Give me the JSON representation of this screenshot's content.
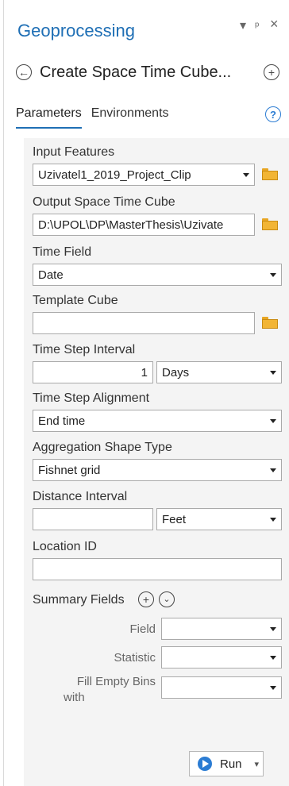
{
  "header": {
    "title": "Geoprocessing",
    "controls": {
      "menu": "▾",
      "pin": "ᵖ",
      "close": "×"
    }
  },
  "tool": {
    "name": "Create Space Time Cube...",
    "back_glyph": "←",
    "add_glyph": "+"
  },
  "tabs": [
    {
      "label": "Parameters",
      "active": true
    },
    {
      "label": "Environments",
      "active": false
    }
  ],
  "help_glyph": "?",
  "params": {
    "input_features": {
      "label": "Input Features",
      "value": "Uzivatel1_2019_Project_Clip"
    },
    "output_cube": {
      "label": "Output Space Time Cube",
      "value": "D:\\UPOL\\DP\\MasterThesis\\Uzivate"
    },
    "time_field": {
      "label": "Time Field",
      "value": "Date"
    },
    "template_cube": {
      "label": "Template Cube",
      "value": ""
    },
    "time_step_interval": {
      "label": "Time Step Interval",
      "value": "1",
      "unit": "Days"
    },
    "time_step_alignment": {
      "label": "Time Step Alignment",
      "value": "End time"
    },
    "aggregation_shape": {
      "label": "Aggregation Shape Type",
      "value": "Fishnet grid"
    },
    "distance_interval": {
      "label": "Distance Interval",
      "value": "",
      "unit": "Feet"
    },
    "location_id": {
      "label": "Location ID",
      "value": ""
    },
    "summary_fields": {
      "label": "Summary Fields",
      "field_label": "Field",
      "statistic_label": "Statistic",
      "fill_label_1": "Fill Empty Bins",
      "fill_label_2": "with"
    }
  },
  "run": {
    "label": "Run",
    "dropdown_glyph": "▾"
  },
  "colors": {
    "accent": "#1f6fb5",
    "folder": "#f2b535",
    "run_icon": "#2b7cd3"
  }
}
